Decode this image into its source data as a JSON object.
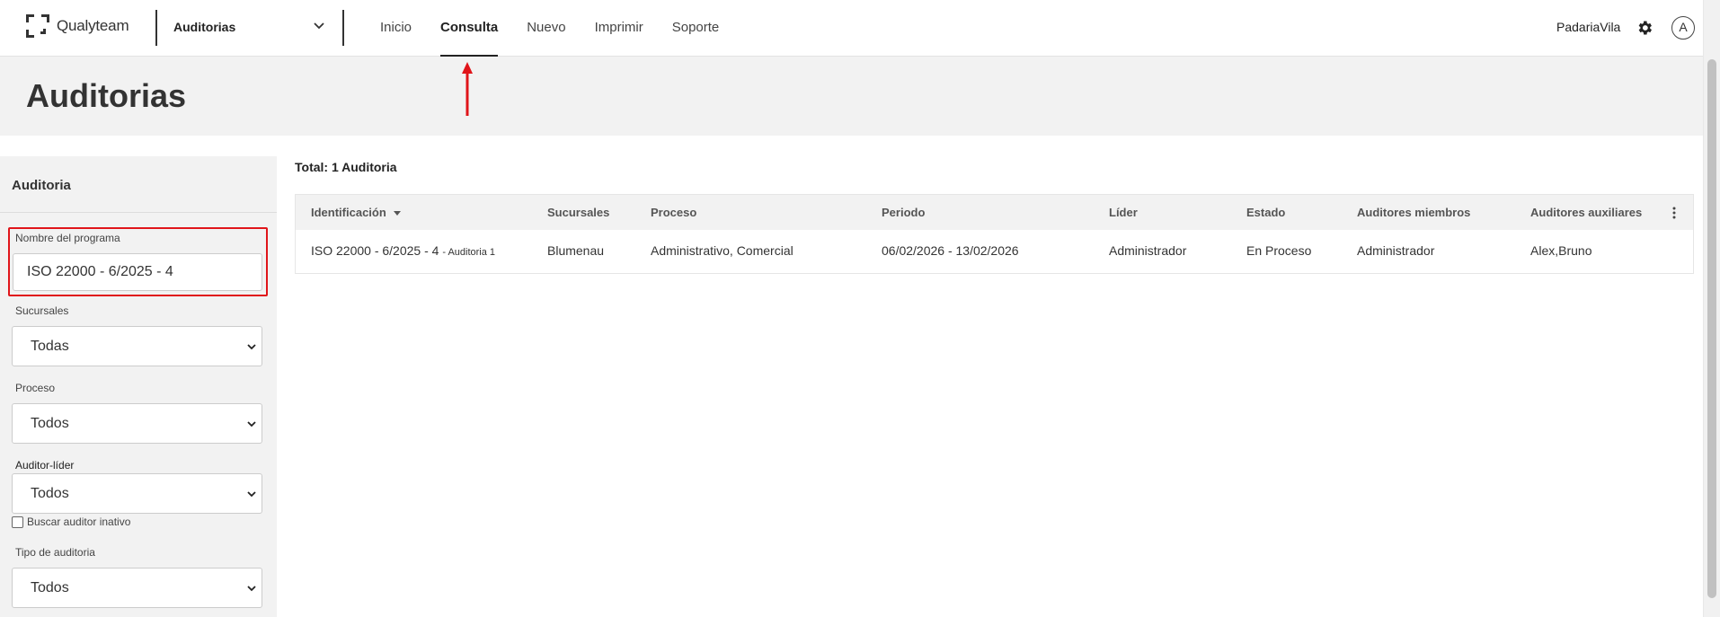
{
  "header": {
    "logo_text": "Qualyteam",
    "module": "Auditorias",
    "nav": [
      "Inicio",
      "Consulta",
      "Nuevo",
      "Imprimir",
      "Soporte"
    ],
    "active_nav": "Consulta",
    "user_name": "PadariaVila",
    "avatar_initial": "A"
  },
  "page": {
    "title": "Auditorias"
  },
  "sidebar": {
    "title": "Auditoria",
    "program_name_label": "Nombre del programa",
    "program_name_value": "ISO 22000 - 6/2025 - 4",
    "branches_label": "Sucursales",
    "branches_value": "Todas",
    "process_label": "Proceso",
    "process_value": "Todos",
    "lead_auditor_label": "Auditor-líder",
    "lead_auditor_value": "Todos",
    "inactive_checkbox_label": "Buscar auditor inativo",
    "audit_type_label": "Tipo de auditoria",
    "audit_type_value": "Todos"
  },
  "main": {
    "total": "Total: 1 Auditoria",
    "columns": [
      "Identificación",
      "Sucursales",
      "Proceso",
      "Periodo",
      "Líder",
      "Estado",
      "Auditores miembros",
      "Auditores auxiliares"
    ],
    "rows": [
      {
        "id": "ISO 22000 - 6/2025 - 4",
        "id_suffix": "- Auditoria 1",
        "branch": "Blumenau",
        "process": "Administrativo, Comercial",
        "period": "06/02/2026 - 13/02/2026",
        "leader": "Administrador",
        "status": "En Proceso",
        "members": "Administrador",
        "auxiliaries": "Alex,Bruno"
      }
    ]
  },
  "colors": {
    "highlight": "#e0151a",
    "arrow": "#e0151a"
  }
}
